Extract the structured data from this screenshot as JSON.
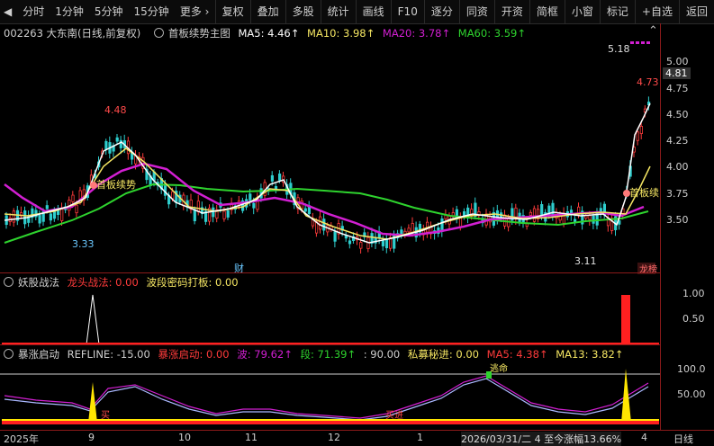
{
  "toolbar": {
    "left": [
      "分时",
      "1分钟",
      "5分钟",
      "15分钟",
      "更多 ›"
    ],
    "right": [
      "复权",
      "叠加",
      "多股",
      "统计",
      "画线",
      "F10",
      "逐分",
      "同资",
      "开资",
      "简框",
      "小窗",
      "标记",
      "+自选",
      "返回"
    ]
  },
  "main_legend": {
    "stock": "002263 大东南(日线,前复权)",
    "indicator": "首板续势主图",
    "ma5": "MA5: 4.46↑",
    "ma10": "MA10: 3.98↑",
    "ma20": "MA20: 3.78↑",
    "ma60": "MA60: 3.59↑"
  },
  "colors": {
    "ma5": "#ffffff",
    "ma10": "#f5e663",
    "ma20": "#d21fd2",
    "ma60": "#2ed32e",
    "up": "#ff3b3b",
    "down": "#2ecece"
  },
  "price_axis": [
    "5.00",
    "4.75",
    "4.50",
    "4.25",
    "4.00",
    "3.75",
    "3.50"
  ],
  "price_current": "4.81",
  "annotations": {
    "high1": "4.48",
    "low1": "3.33",
    "low2": "3.11",
    "high2": "5.18",
    "last": "4.73",
    "tag1": "首板续势",
    "tag2": "首板续",
    "cai": "财",
    "bang": "龙榜"
  },
  "pane2": {
    "title": "妖股战法",
    "a": "龙头战法: 0.00",
    "b": "波段密码打板: 0.00",
    "axis": [
      "1.00",
      "0.50"
    ]
  },
  "pane3": {
    "title": "暴涨启动",
    "ref": "REFLINE: -15.00",
    "a": "暴涨启动: 0.00",
    "b": "波: 79.62↑",
    "c": "段: 71.39↑",
    "d": ": 90.00",
    "e": "私募秘进: 0.00",
    "f": "MA5: 4.38↑",
    "g": "MA13: 3.82↑",
    "axis": [
      "100.0",
      "50.00"
    ],
    "tag_escape": "逃命",
    "tag_buy": "买",
    "tag_buy2": "买进"
  },
  "xaxis": {
    "labels": [
      "2025年",
      "9",
      "10",
      "11",
      "12",
      "1",
      "2026/03/31/二 4 至今涨幅13.66%",
      "4"
    ],
    "right": "日线"
  }
}
